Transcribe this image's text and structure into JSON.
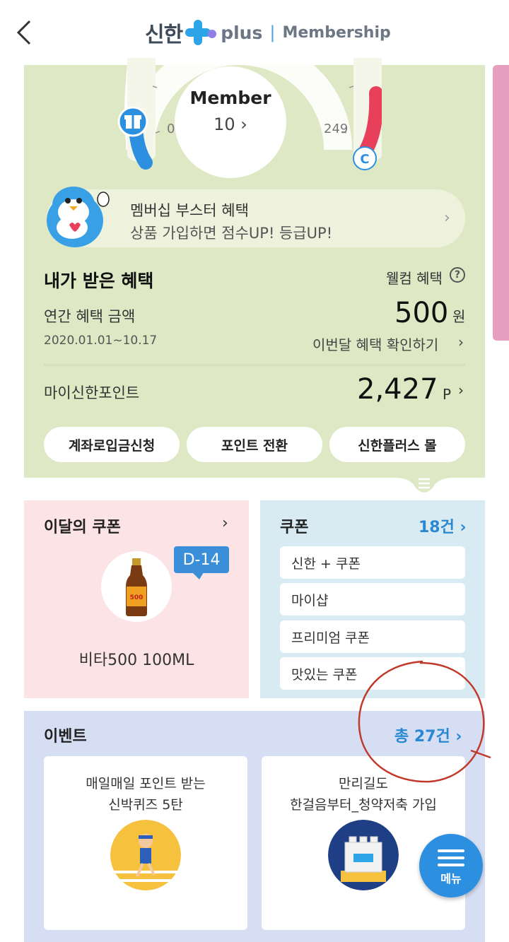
{
  "header": {
    "brand_main": "신한",
    "brand_plus": "plus",
    "brand_divider": "|",
    "brand_membership": "Membership"
  },
  "gauge": {
    "grade": "Member",
    "score": "10 ›",
    "min_label": "0",
    "max_label": "249"
  },
  "booster": {
    "title": "멤버십 부스터 혜택",
    "subtitle": "상품 가입하면 점수UP! 등급UP!",
    "arrow": "›"
  },
  "benefits": {
    "title": "내가 받은 혜택",
    "welcome_label": "웰컴 혜택",
    "help_symbol": "?",
    "annual_label": "연간 혜택 금액",
    "annual_value": "500",
    "annual_unit": "원",
    "date_range": "2020.01.01~10.17",
    "month_check": "이번달 혜택 확인하기",
    "month_arrow": "›",
    "point_label": "마이신한포인트",
    "point_value": "2,427",
    "point_unit": "P",
    "point_arrow": "›"
  },
  "actions": [
    {
      "label": "계좌로입금신청"
    },
    {
      "label": "포인트 전환"
    },
    {
      "label": "신한플러스 몰"
    }
  ],
  "month_coupon": {
    "title": "이달의 쿠폰",
    "arrow": "›",
    "badge": "D-14",
    "product": "비타500 100ML"
  },
  "coupons": {
    "title": "쿠폰",
    "count": "18건 ›",
    "items": [
      {
        "label": "신한 + 쿠폰"
      },
      {
        "label": "마이샵"
      },
      {
        "label": "프리미엄 쿠폰"
      },
      {
        "label": "맛있는 쿠폰"
      }
    ]
  },
  "events": {
    "title": "이벤트",
    "count": "총 27건 ›",
    "cards": [
      {
        "line1": "매일매일 포인트 받는",
        "line2": "신박퀴즈 5탄"
      },
      {
        "line1": "만리길도",
        "line2": "한걸음부터_청약저축 가입"
      }
    ]
  },
  "menu_fab": {
    "label": "메뉴"
  },
  "colors": {
    "green_card": "#dfe8c4",
    "accent_blue": "#2a88d2",
    "gauge_red": "#e8405a",
    "gauge_blue": "#2d8fe0",
    "pink_panel": "#fce4e6",
    "blue_panel": "#d8ebf3",
    "event_panel": "#d6def3",
    "annotation_red": "#c0392b"
  }
}
